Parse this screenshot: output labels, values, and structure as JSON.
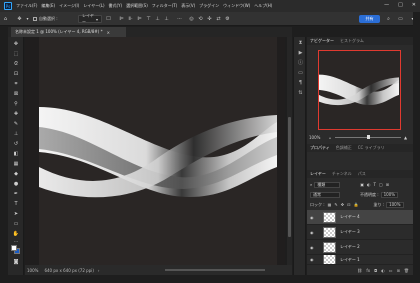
{
  "menubar": {
    "logo": "Ps",
    "items": [
      "ファイル(F)",
      "編集(E)",
      "イメージ(I)",
      "レイヤー(L)",
      "書式(Y)",
      "選択範囲(S)",
      "フィルター(T)",
      "表示(V)",
      "プラグイン",
      "ウィンドウ(W)",
      "ヘルプ(H)"
    ],
    "window_controls": [
      "—",
      "□",
      "✕"
    ]
  },
  "options": {
    "move_icon": "move-icon",
    "auto_select_label": "自動選択 :",
    "auto_select_target": "レイヤー",
    "share_label": "共有"
  },
  "document": {
    "tab_title": "名称未設定 1 @ 100% (レイヤー 4, RGB/8#) *",
    "close": "×"
  },
  "status": {
    "zoom": "100%",
    "info": "640 px x 640 px (72 ppi)",
    "arrow": "›"
  },
  "navigator": {
    "tabs": [
      "ナビゲーター",
      "ヒストグラム"
    ],
    "zoom": "100%"
  },
  "props_tabs": [
    "プロパティ",
    "色調補正",
    "CC ライブラリ"
  ],
  "layers": {
    "tabs": [
      "レイヤー",
      "チャンネル",
      "パス"
    ],
    "search_kind": "種類",
    "blend_mode": "通常",
    "opacity_label": "不透明度 :",
    "opacity": "100%",
    "lock_label": "ロック :",
    "fill_label": "塗り :",
    "fill": "100%",
    "items": [
      {
        "name": "レイヤー 4",
        "selected": true
      },
      {
        "name": "レイヤー 3",
        "selected": false
      },
      {
        "name": "レイヤー 2",
        "selected": false
      },
      {
        "name": "レイヤー 1",
        "selected": false
      }
    ]
  },
  "colors": {
    "accent": "#2b6ed6",
    "navigator_frame": "#e03a30",
    "canvas_bg": "#2a2625"
  }
}
